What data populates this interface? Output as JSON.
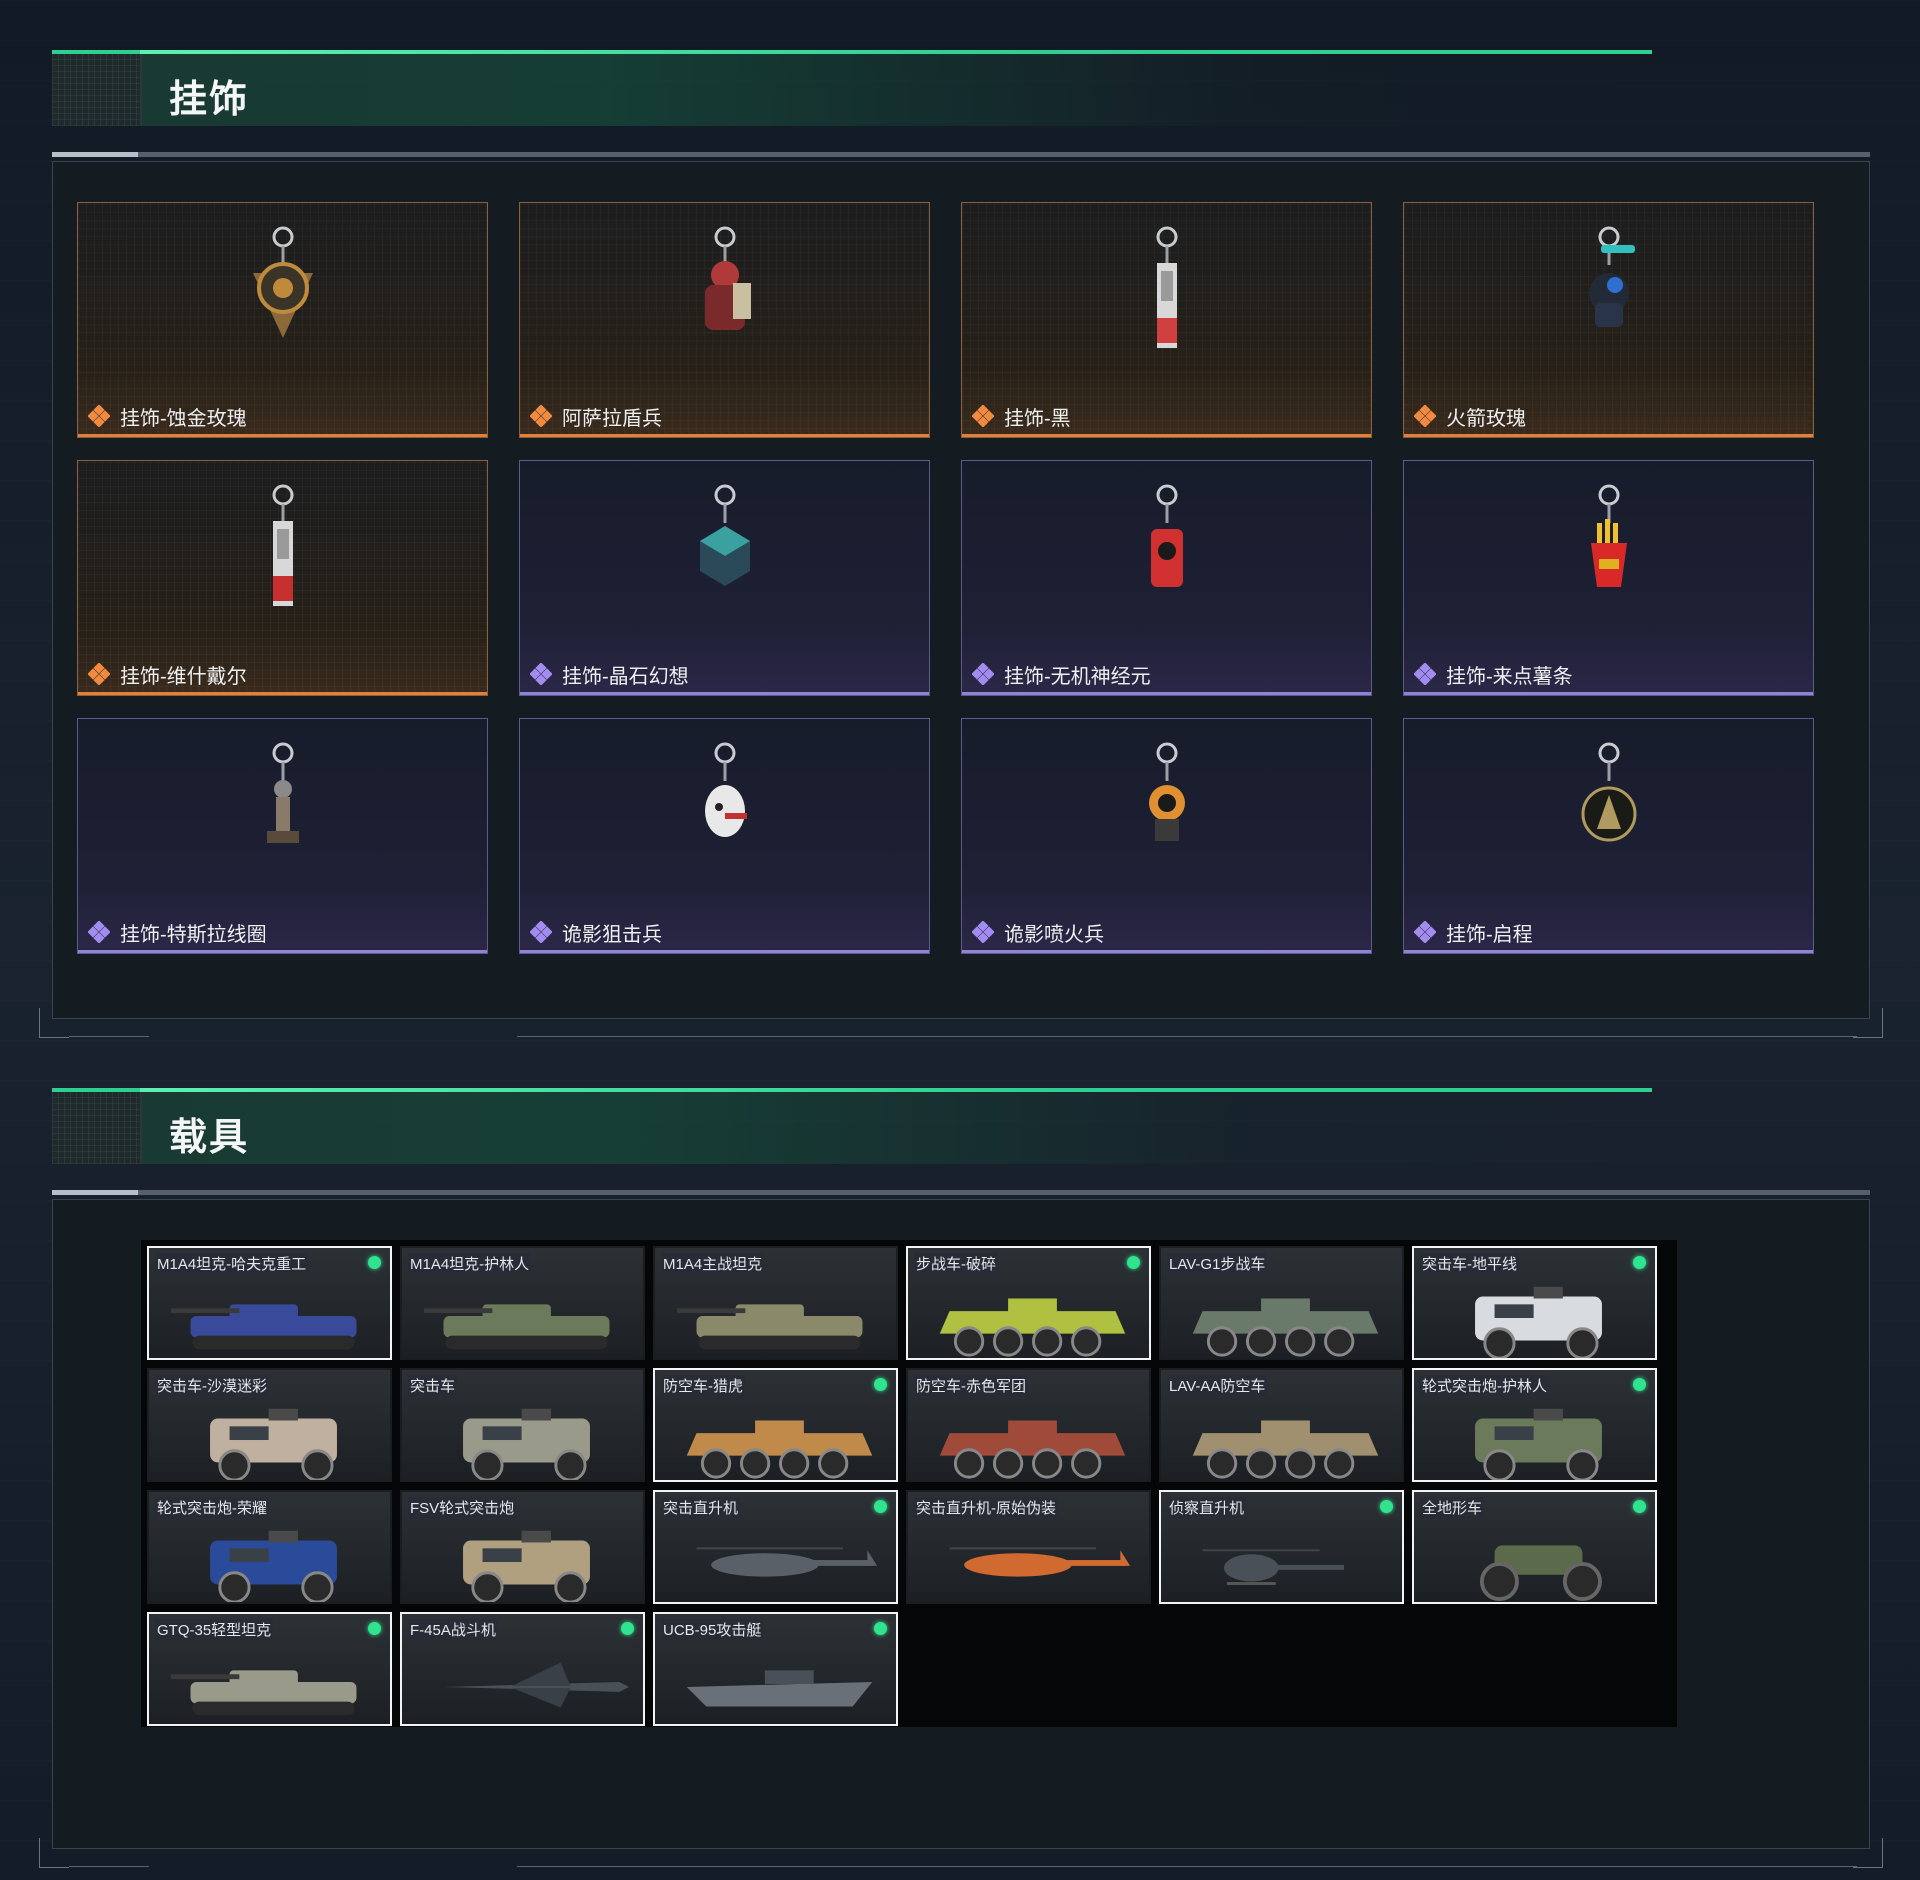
{
  "sections": {
    "charms": {
      "title": "挂饰"
    },
    "vehicles": {
      "title": "载具"
    }
  },
  "charms": [
    {
      "label": "挂饰-蚀金玫瑰",
      "rarity": "gold",
      "icon": "rose-medallion-charm-icon",
      "color": "#c08a3c"
    },
    {
      "label": "阿萨拉盾兵",
      "rarity": "gold",
      "icon": "shield-soldier-charm-icon",
      "color": "#b03a3a"
    },
    {
      "label": "挂饰-黑",
      "rarity": "gold",
      "icon": "tag-charm-icon",
      "color": "#d04040"
    },
    {
      "label": "火箭玫瑰",
      "rarity": "gold",
      "icon": "rocket-figure-charm-icon",
      "color": "#2f6fd0"
    },
    {
      "label": "挂饰-维什戴尔",
      "rarity": "gold",
      "icon": "tag-charm-icon",
      "color": "#c83030"
    },
    {
      "label": "挂饰-晶石幻想",
      "rarity": "purple",
      "icon": "crystal-cube-charm-icon",
      "color": "#3aa0a0"
    },
    {
      "label": "挂饰-无机神经元",
      "rarity": "purple",
      "icon": "neuron-charm-icon",
      "color": "#d03030"
    },
    {
      "label": "挂饰-来点薯条",
      "rarity": "purple",
      "icon": "fries-charm-icon",
      "color": "#e0b020"
    },
    {
      "label": "挂饰-特斯拉线圈",
      "rarity": "purple",
      "icon": "tesla-coil-charm-icon",
      "color": "#8a7a6a"
    },
    {
      "label": "诡影狙击兵",
      "rarity": "purple",
      "icon": "ghost-sniper-charm-icon",
      "color": "#e8e8e8"
    },
    {
      "label": "诡影喷火兵",
      "rarity": "purple",
      "icon": "ghost-flamer-charm-icon",
      "color": "#e09030"
    },
    {
      "label": "挂饰-启程",
      "rarity": "purple",
      "icon": "badge-charm-icon",
      "color": "#b09a60"
    }
  ],
  "vehicles": [
    {
      "label": "M1A4坦克-哈夫克重工",
      "owned": true,
      "kind": "tank",
      "color": "#3a4a9a"
    },
    {
      "label": "M1A4坦克-护林人",
      "owned": false,
      "kind": "tank",
      "color": "#6a7a5a"
    },
    {
      "label": "M1A4主战坦克",
      "owned": false,
      "kind": "tank",
      "color": "#8a8a6a"
    },
    {
      "label": "步战车-破碎",
      "owned": true,
      "kind": "ifv",
      "color": "#b0c040"
    },
    {
      "label": "LAV-G1步战车",
      "owned": false,
      "kind": "ifv",
      "color": "#6a7a6a"
    },
    {
      "label": "突击车-地平线",
      "owned": true,
      "kind": "armored-car",
      "color": "#d8dce0"
    },
    {
      "label": "突击车-沙漠迷彩",
      "owned": false,
      "kind": "armored-car",
      "color": "#c0b0a0"
    },
    {
      "label": "突击车",
      "owned": false,
      "kind": "armored-car",
      "color": "#9a9a8a"
    },
    {
      "label": "防空车-猎虎",
      "owned": true,
      "kind": "ifv",
      "color": "#c08a4a"
    },
    {
      "label": "防空车-赤色军团",
      "owned": false,
      "kind": "ifv",
      "color": "#a04a3a"
    },
    {
      "label": "LAV-AA防空车",
      "owned": false,
      "kind": "ifv",
      "color": "#a09070"
    },
    {
      "label": "轮式突击炮-护林人",
      "owned": true,
      "kind": "armored-car",
      "color": "#6a7a5a"
    },
    {
      "label": "轮式突击炮-荣耀",
      "owned": false,
      "kind": "armored-car",
      "color": "#2a4a9a"
    },
    {
      "label": "FSV轮式突击炮",
      "owned": false,
      "kind": "armored-car",
      "color": "#b0a080"
    },
    {
      "label": "突击直升机",
      "owned": true,
      "kind": "helicopter",
      "color": "#5a6068"
    },
    {
      "label": "突击直升机-原始伪装",
      "owned": false,
      "kind": "helicopter",
      "color": "#d06a30"
    },
    {
      "label": "侦察直升机",
      "owned": true,
      "kind": "small-helicopter",
      "color": "#4a5058"
    },
    {
      "label": "全地形车",
      "owned": true,
      "kind": "atv",
      "color": "#5a6a4a"
    },
    {
      "label": "GTQ-35轻型坦克",
      "owned": true,
      "kind": "tank",
      "color": "#9a9a8a"
    },
    {
      "label": "F-45A战斗机",
      "owned": true,
      "kind": "jet",
      "color": "#4a5058"
    },
    {
      "label": "UCB-95攻击艇",
      "owned": true,
      "kind": "boat",
      "color": "#6a7078"
    }
  ]
}
